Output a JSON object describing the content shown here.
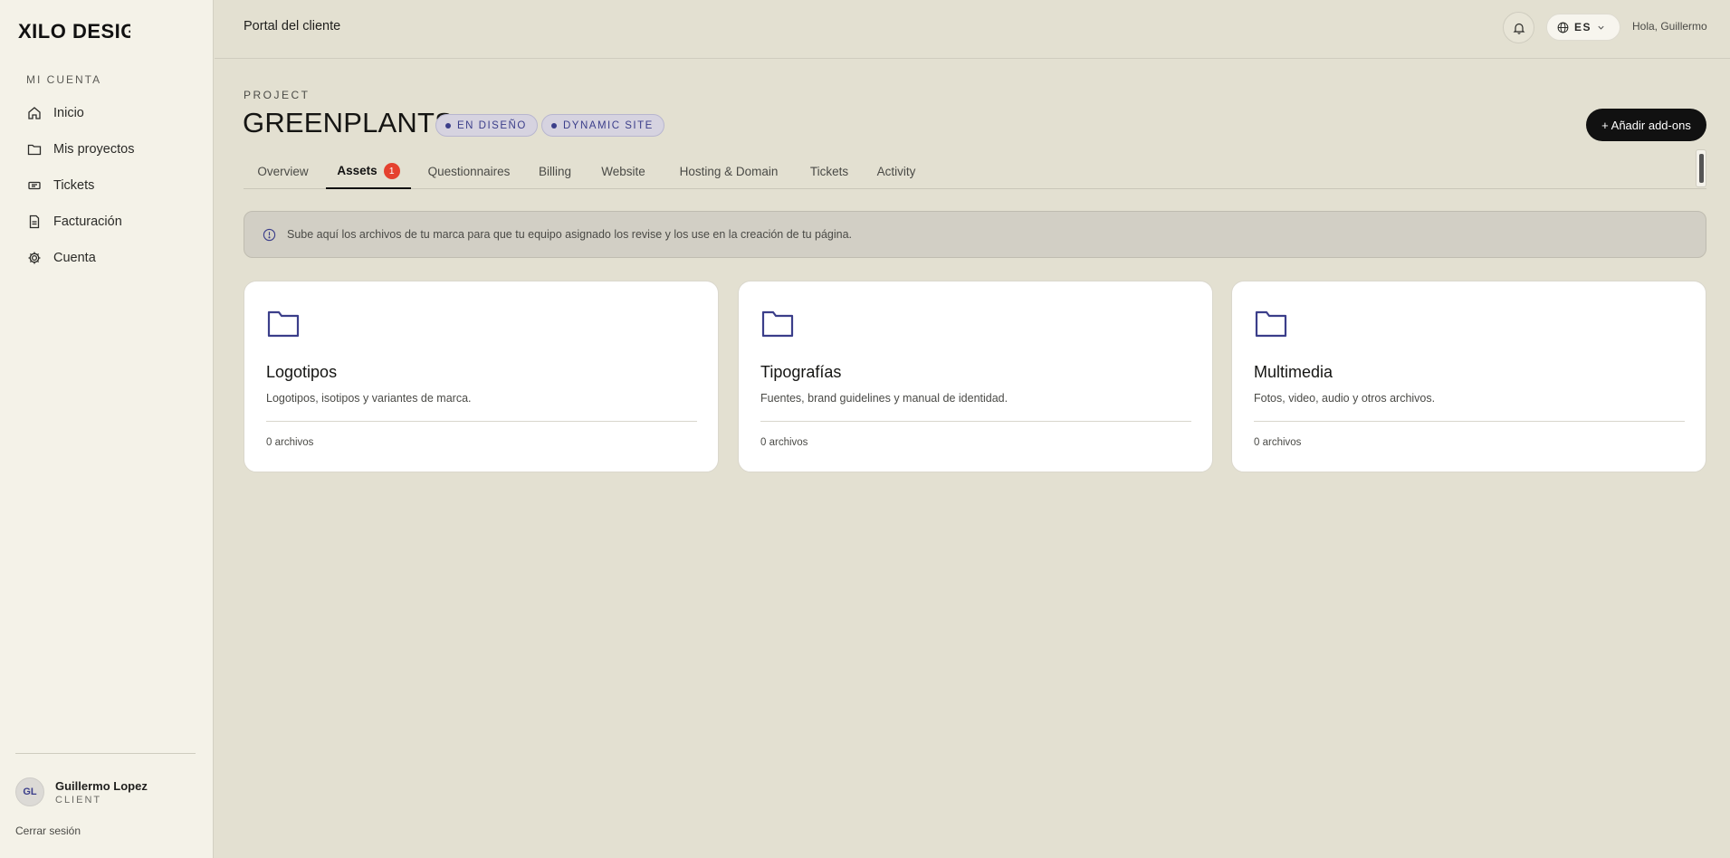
{
  "brand": {
    "logo_text": "XILO DESIGN",
    "accent": "#3b3e8a",
    "badge_red": "#e5412f"
  },
  "sidebar": {
    "section_label": "MI CUENTA",
    "items": [
      {
        "label": "Inicio",
        "icon": "home-icon"
      },
      {
        "label": "Mis proyectos",
        "icon": "folder-icon"
      },
      {
        "label": "Tickets",
        "icon": "ticket-icon"
      },
      {
        "label": "Facturación",
        "icon": "invoice-icon"
      },
      {
        "label": "Cuenta",
        "icon": "gear-icon"
      }
    ],
    "user": {
      "initials": "GL",
      "name": "Guillermo Lopez",
      "role": "CLIENT"
    },
    "logout_label": "Cerrar sesión"
  },
  "header": {
    "title": "Portal del cliente",
    "language": "ES",
    "greeting": "Hola, Guillermo"
  },
  "project": {
    "label": "PROJECT",
    "name": "GREENPLANTS",
    "badges": [
      "EN DISEÑO",
      "DYNAMIC SITE"
    ],
    "addons_label": "+ Añadir add-ons"
  },
  "tabs": [
    {
      "label": "Overview"
    },
    {
      "label": "Assets",
      "count": "1",
      "active": true
    },
    {
      "label": "Questionnaires"
    },
    {
      "label": "Billing"
    },
    {
      "label": "Website"
    },
    {
      "label": "Hosting & Domain"
    },
    {
      "label": "Tickets"
    },
    {
      "label": "Activity"
    }
  ],
  "info_banner": {
    "text": "Sube aquí los archivos de tu marca para que tu equipo asignado los revise y los use en la creación de tu página."
  },
  "cards": [
    {
      "title": "Logotipos",
      "description": "Logotipos, isotipos y variantes de marca.",
      "count": "0 archivos"
    },
    {
      "title": "Tipografías",
      "description": "Fuentes, brand guidelines y manual de identidad.",
      "count": "0 archivos"
    },
    {
      "title": "Multimedia",
      "description": "Fotos, video, audio y otros archivos.",
      "count": "0 archivos"
    }
  ]
}
